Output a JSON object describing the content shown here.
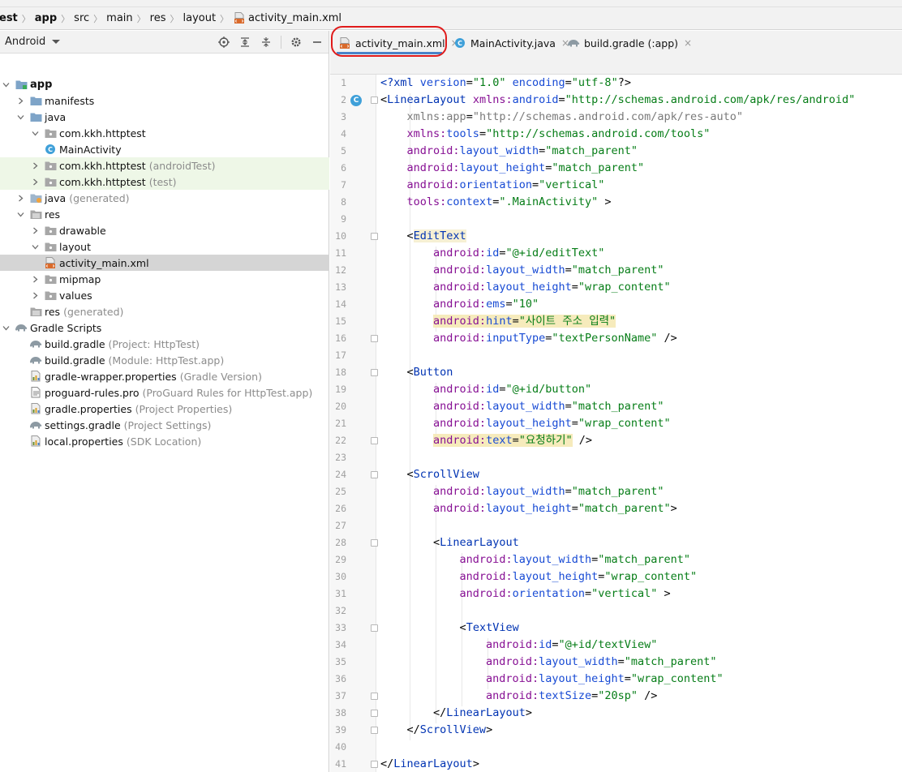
{
  "breadcrumb": [
    "est",
    "app",
    "src",
    "main",
    "res",
    "layout",
    "activity_main.xml"
  ],
  "project_panel": {
    "view_selector": "Android",
    "tree": [
      {
        "label": "app",
        "extra": "",
        "depth": 0,
        "arrow": "down",
        "icon": "module-icon",
        "bold": true,
        "style": ""
      },
      {
        "label": "manifests",
        "extra": "",
        "depth": 1,
        "arrow": "right",
        "icon": "folder-icon",
        "bold": false,
        "style": ""
      },
      {
        "label": "java",
        "extra": "",
        "depth": 1,
        "arrow": "down",
        "icon": "folder-icon",
        "bold": false,
        "style": ""
      },
      {
        "label": "com.kkh.httptest",
        "extra": "",
        "depth": 2,
        "arrow": "down",
        "icon": "package-icon",
        "bold": false,
        "style": ""
      },
      {
        "label": "MainActivity",
        "extra": "",
        "depth": 3,
        "arrow": "none",
        "icon": "class-icon",
        "bold": false,
        "style": ""
      },
      {
        "label": "com.kkh.httptest",
        "extra": "(androidTest)",
        "depth": 2,
        "arrow": "right",
        "icon": "package-icon",
        "bold": false,
        "style": "green"
      },
      {
        "label": "com.kkh.httptest",
        "extra": "(test)",
        "depth": 2,
        "arrow": "right",
        "icon": "package-icon",
        "bold": false,
        "style": "green"
      },
      {
        "label": "java",
        "extra": "(generated)",
        "depth": 1,
        "arrow": "right",
        "icon": "generated-folder-icon",
        "bold": false,
        "style": ""
      },
      {
        "label": "res",
        "extra": "",
        "depth": 1,
        "arrow": "down",
        "icon": "res-folder-icon",
        "bold": false,
        "style": ""
      },
      {
        "label": "drawable",
        "extra": "",
        "depth": 2,
        "arrow": "right",
        "icon": "package-icon",
        "bold": false,
        "style": ""
      },
      {
        "label": "layout",
        "extra": "",
        "depth": 2,
        "arrow": "down",
        "icon": "package-icon",
        "bold": false,
        "style": ""
      },
      {
        "label": "activity_main.xml",
        "extra": "",
        "depth": 3,
        "arrow": "none",
        "icon": "xml-file-icon",
        "bold": false,
        "style": "sel"
      },
      {
        "label": "mipmap",
        "extra": "",
        "depth": 2,
        "arrow": "right",
        "icon": "package-icon",
        "bold": false,
        "style": ""
      },
      {
        "label": "values",
        "extra": "",
        "depth": 2,
        "arrow": "right",
        "icon": "package-icon",
        "bold": false,
        "style": ""
      },
      {
        "label": "res",
        "extra": "(generated)",
        "depth": 1,
        "arrow": "none",
        "icon": "res-folder-icon",
        "bold": false,
        "style": ""
      },
      {
        "label": "Gradle Scripts",
        "extra": "",
        "depth": 0,
        "arrow": "down",
        "icon": "gradle-icon",
        "bold": false,
        "style": ""
      },
      {
        "label": "build.gradle",
        "extra": "(Project: HttpTest)",
        "depth": 1,
        "arrow": "none",
        "icon": "gradle-icon",
        "bold": false,
        "style": ""
      },
      {
        "label": "build.gradle",
        "extra": "(Module: HttpTest.app)",
        "depth": 1,
        "arrow": "none",
        "icon": "gradle-icon",
        "bold": false,
        "style": ""
      },
      {
        "label": "gradle-wrapper.properties",
        "extra": "(Gradle Version)",
        "depth": 1,
        "arrow": "none",
        "icon": "properties-icon",
        "bold": false,
        "style": ""
      },
      {
        "label": "proguard-rules.pro",
        "extra": "(ProGuard Rules for HttpTest.app)",
        "depth": 1,
        "arrow": "none",
        "icon": "text-file-icon",
        "bold": false,
        "style": ""
      },
      {
        "label": "gradle.properties",
        "extra": "(Project Properties)",
        "depth": 1,
        "arrow": "none",
        "icon": "properties-icon",
        "bold": false,
        "style": ""
      },
      {
        "label": "settings.gradle",
        "extra": "(Project Settings)",
        "depth": 1,
        "arrow": "none",
        "icon": "gradle-icon",
        "bold": false,
        "style": ""
      },
      {
        "label": "local.properties",
        "extra": "(SDK Location)",
        "depth": 1,
        "arrow": "none",
        "icon": "properties-icon",
        "bold": false,
        "style": ""
      }
    ]
  },
  "editor": {
    "tabs": [
      {
        "label": "activity_main.xml",
        "icon": "xml-file-icon",
        "active": true
      },
      {
        "label": "MainActivity.java",
        "icon": "class-icon",
        "active": false
      },
      {
        "label": "build.gradle (:app)",
        "icon": "gradle-icon",
        "active": false
      }
    ],
    "lines": [
      "<?xml version=\"1.0\" encoding=\"utf-8\"?>",
      "<LinearLayout xmlns:android=\"http://schemas.android.com/apk/res/android\"",
      "    xmlns:app=\"http://schemas.android.com/apk/res-auto\"",
      "    xmlns:tools=\"http://schemas.android.com/tools\"",
      "    android:layout_width=\"match_parent\"",
      "    android:layout_height=\"match_parent\"",
      "    android:orientation=\"vertical\"",
      "    tools:context=\".MainActivity\" >",
      "",
      "    <EditText",
      "        android:id=\"@+id/editText\"",
      "        android:layout_width=\"match_parent\"",
      "        android:layout_height=\"wrap_content\"",
      "        android:ems=\"10\"",
      "        android:hint=\"사이트 주소 입력\"",
      "        android:inputType=\"textPersonName\" />",
      "",
      "    <Button",
      "        android:id=\"@+id/button\"",
      "        android:layout_width=\"match_parent\"",
      "        android:layout_height=\"wrap_content\"",
      "        android:text=\"요청하기\" />",
      "",
      "    <ScrollView",
      "        android:layout_width=\"match_parent\"",
      "        android:layout_height=\"match_parent\">",
      "",
      "        <LinearLayout",
      "            android:layout_width=\"match_parent\"",
      "            android:layout_height=\"wrap_content\"",
      "            android:orientation=\"vertical\" >",
      "",
      "            <TextView",
      "                android:id=\"@+id/textView\"",
      "                android:layout_width=\"match_parent\"",
      "                android:layout_height=\"wrap_content\"",
      "                android:textSize=\"20sp\" />",
      "        </LinearLayout>",
      "    </ScrollView>",
      "",
      "</LinearLayout>"
    ]
  },
  "colors": {
    "accent": "#4a83c9",
    "highlight_box": "#e01b1b",
    "tag": "#0033b3",
    "namespace": "#871094",
    "attribute": "#174ad4",
    "string": "#067d17",
    "warning_bg": "#f6ebbc"
  }
}
